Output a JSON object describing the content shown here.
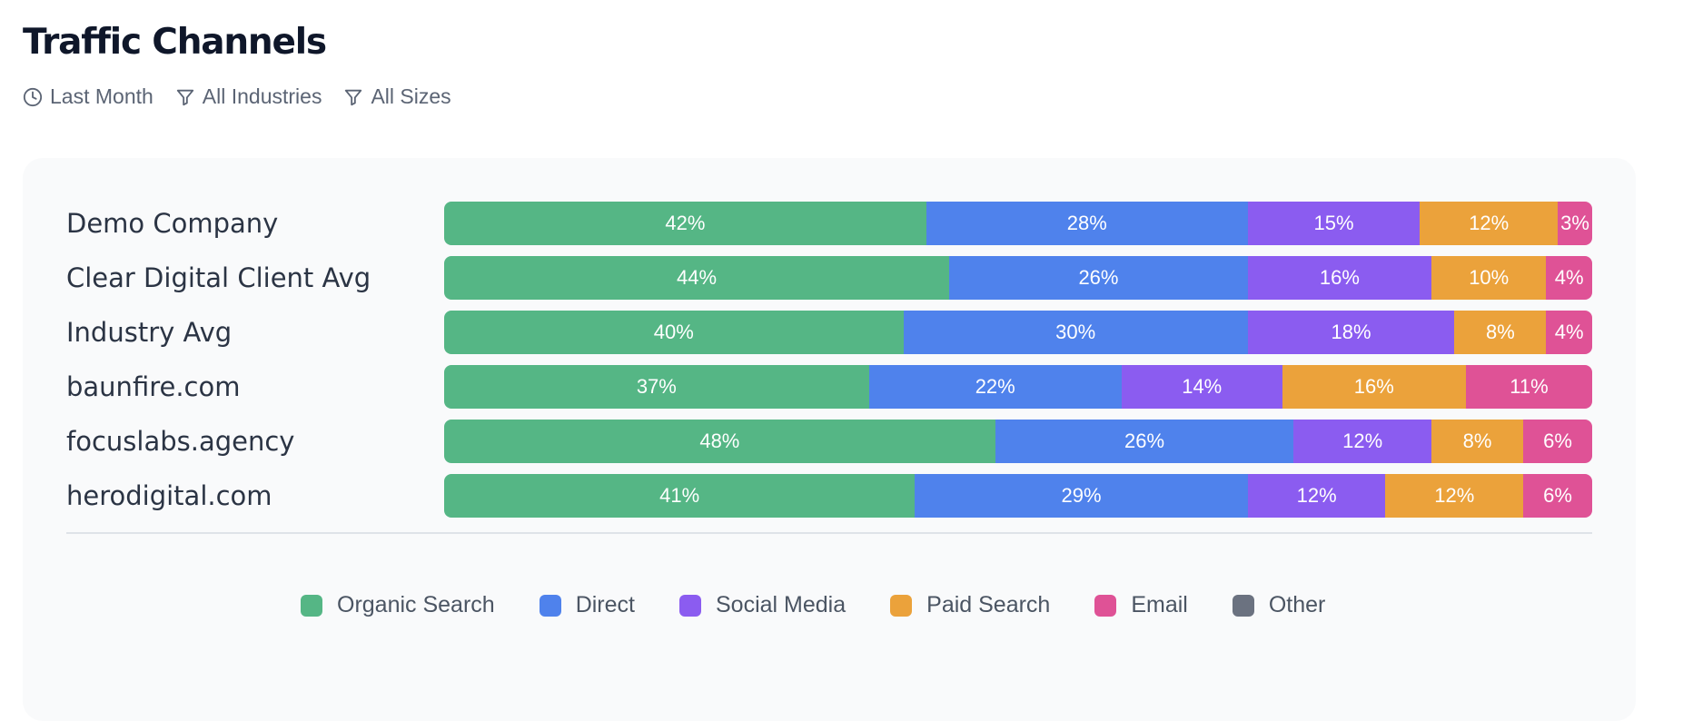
{
  "header": {
    "title": "Traffic Channels",
    "filters": [
      {
        "label": "Last Month",
        "icon": "clock-icon"
      },
      {
        "label": "All Industries",
        "icon": "filter-icon"
      },
      {
        "label": "All Sizes",
        "icon": "filter-icon"
      }
    ]
  },
  "colors": {
    "Organic Search": "#55b685",
    "Direct": "#4f82ec",
    "Social Media": "#8b5cf0",
    "Paid Search": "#eba23b",
    "Email": "#df5296",
    "Other": "#6b7280"
  },
  "chart_data": {
    "type": "bar",
    "orientation": "horizontal",
    "stacked": true,
    "normalized_percent": true,
    "categories": [
      "Demo Company",
      "Clear Digital Client Avg",
      "Industry Avg",
      "baunfire.com",
      "focuslabs.agency",
      "herodigital.com"
    ],
    "series": [
      {
        "name": "Organic Search",
        "values": [
          42,
          44,
          40,
          37,
          48,
          41
        ]
      },
      {
        "name": "Direct",
        "values": [
          28,
          26,
          30,
          22,
          26,
          29
        ]
      },
      {
        "name": "Social Media",
        "values": [
          15,
          16,
          18,
          14,
          12,
          12
        ]
      },
      {
        "name": "Paid Search",
        "values": [
          12,
          10,
          8,
          16,
          8,
          12
        ]
      },
      {
        "name": "Email",
        "values": [
          3,
          4,
          4,
          11,
          6,
          6
        ]
      },
      {
        "name": "Other",
        "values": [
          0,
          0,
          0,
          0,
          0,
          0
        ]
      }
    ],
    "legend_position": "bottom",
    "grid": false,
    "value_labels": "percent"
  }
}
